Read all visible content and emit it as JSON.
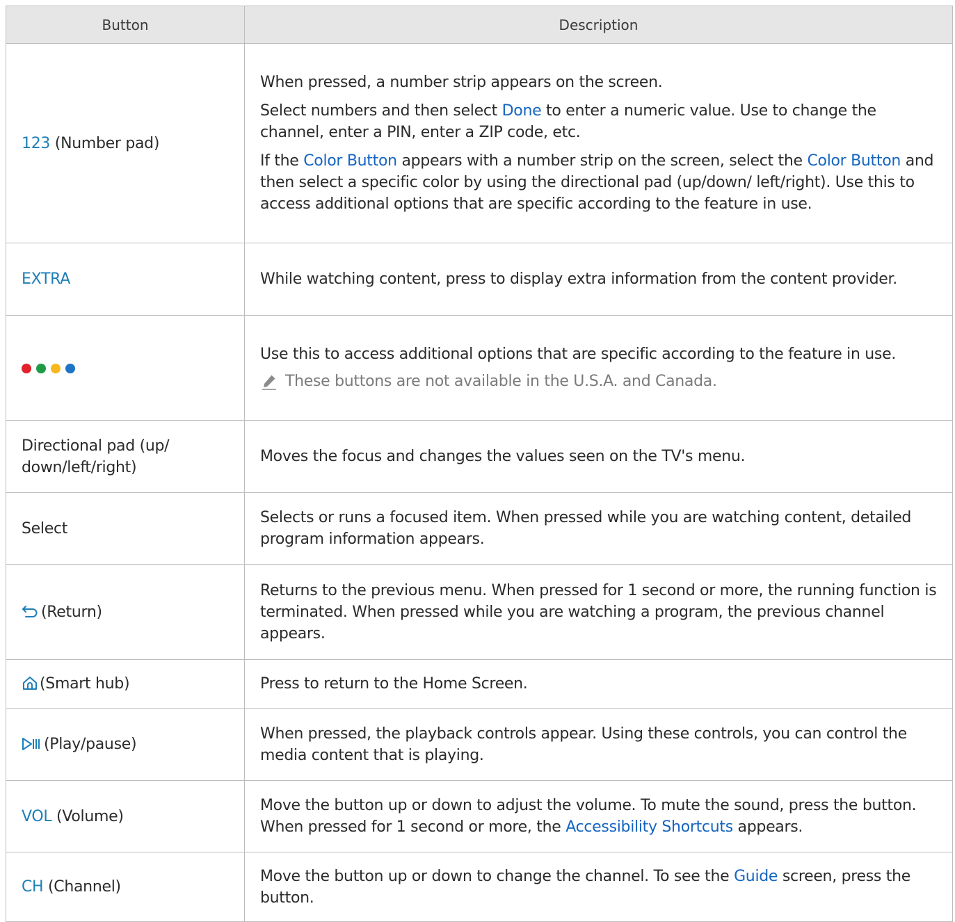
{
  "header": {
    "col_button": "Button",
    "col_description": "Description"
  },
  "colors": {
    "highlight": "#1e7fb8",
    "link": "#1565c0",
    "dots": [
      "#e0222c",
      "#1f9b45",
      "#f6b81c",
      "#1d74c4"
    ]
  },
  "rows": {
    "number_pad": {
      "key": "123",
      "label": " (Number pad)",
      "p1": "When pressed, a number strip appears on the screen.",
      "p2_a": "Select numbers and then select ",
      "p2_link": "Done",
      "p2_b": " to enter a numeric value. Use to change the channel, enter a PIN, enter a ZIP code, etc.",
      "p3_a": "If the ",
      "p3_link1": "Color Button",
      "p3_b": " appears with a number strip on the screen, select the ",
      "p3_link2": "Color Button",
      "p3_c": " and then select a specific color by using the directional pad (up/down/ left/right). Use this to access additional options that are specific according to the feature in use."
    },
    "extra": {
      "key": "EXTRA",
      "desc": "While watching content, press to display extra information from the content provider."
    },
    "color_buttons": {
      "icon": "colored-dots-icon",
      "desc": "Use this to access additional options that are specific according to the feature in use.",
      "note_icon": "pencil-note-icon",
      "note": "These buttons are not available in the U.S.A. and Canada."
    },
    "directional": {
      "label": "Directional pad  (up/ down/left/right)",
      "desc": "Moves the focus and changes the values seen on the TV's menu."
    },
    "select": {
      "label": "Select",
      "desc": "Selects or runs a focused item. When pressed while you are watching content, detailed program information appears."
    },
    "return": {
      "icon": "return-arrow-icon",
      "label": "(Return)",
      "desc": "Returns to the previous menu. When pressed for 1 second or more, the running function is terminated. When pressed while you are watching a program, the previous channel appears."
    },
    "smart_hub": {
      "icon": "home-icon",
      "label": "(Smart hub)",
      "desc": "Press to return to the Home Screen."
    },
    "play_pause": {
      "icon": "play-pause-icon",
      "label": "(Play/pause)",
      "desc": "When pressed, the playback controls appear. Using these controls, you can control the media content that is playing."
    },
    "volume": {
      "key": "VOL",
      "label": " (Volume)",
      "desc_a": "Move the button up or down to adjust the volume. To mute the sound, press the button. When pressed for 1 second or more, the ",
      "desc_link": "Accessibility Shortcuts",
      "desc_b": " appears."
    },
    "channel": {
      "key": "CH",
      "label": " (Channel)",
      "desc_a": "Move the button up or down to change the channel. To see the ",
      "desc_link": "Guide",
      "desc_b": " screen, press the button."
    }
  }
}
